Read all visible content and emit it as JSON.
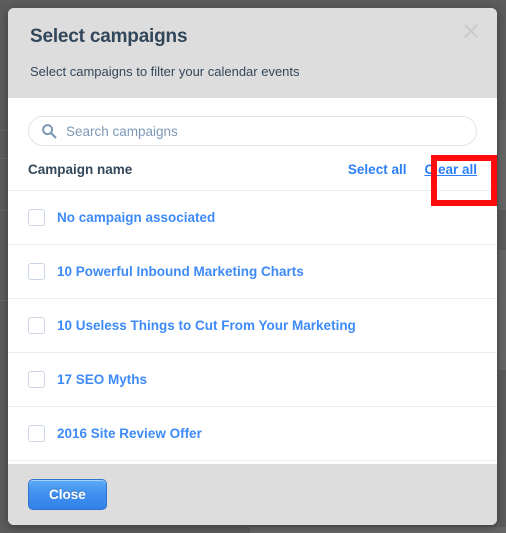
{
  "modal": {
    "title": "Select campaigns",
    "subtitle": "Select campaigns to filter your calendar events",
    "close_icon": "close-x-icon"
  },
  "search": {
    "icon": "search-icon",
    "placeholder": "Search campaigns",
    "value": ""
  },
  "list_header": {
    "column_title": "Campaign name",
    "select_all_label": "Select all",
    "clear_all_label": "Clear all"
  },
  "annotation": {
    "target": "Clear all",
    "color": "#fb0d0d"
  },
  "campaigns": [
    {
      "label": "No campaign associated",
      "checked": false
    },
    {
      "label": "10 Powerful Inbound Marketing Charts",
      "checked": false
    },
    {
      "label": "10 Useless Things to Cut From Your Marketing",
      "checked": false
    },
    {
      "label": "17 SEO Myths",
      "checked": false
    },
    {
      "label": "2016 Site Review Offer",
      "checked": false
    }
  ],
  "footer": {
    "close_label": "Close"
  },
  "colors": {
    "link": "#2d7ff9",
    "campaign_link": "#3e8bf7",
    "header_bg": "#dddddd",
    "annotation": "#fb0d0d",
    "primary_button": "#3f8ff0"
  }
}
